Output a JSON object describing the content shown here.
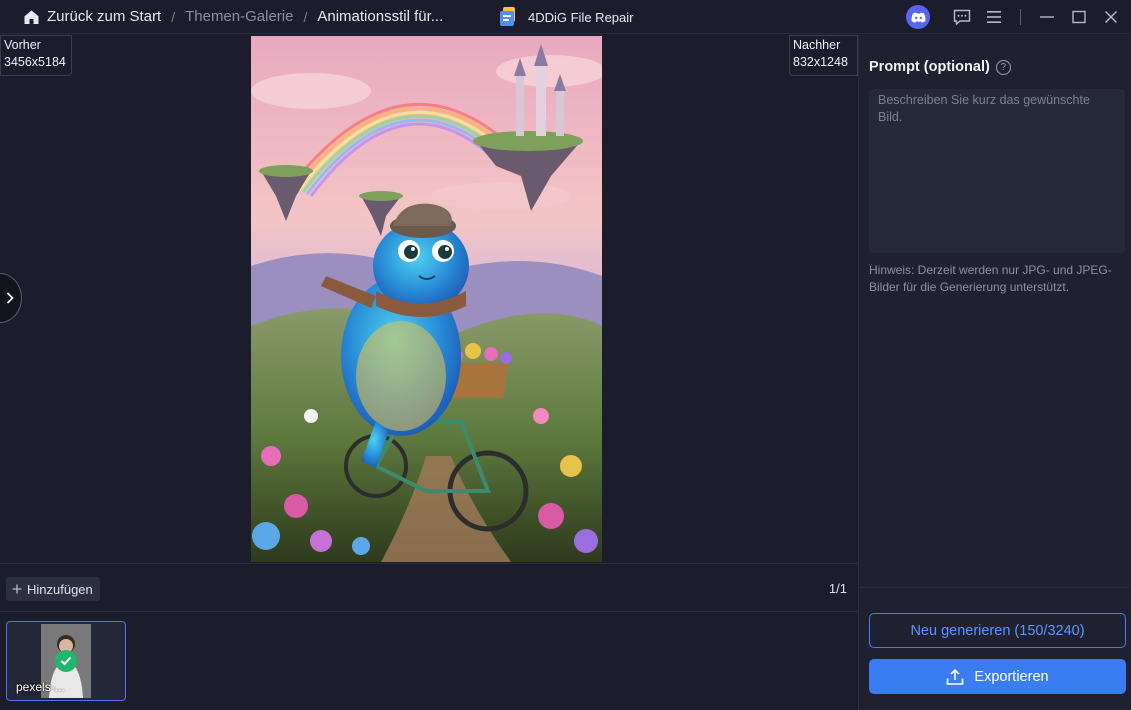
{
  "breadcrumb": {
    "home": "Zurück zum Start",
    "gallery": "Themen-Galerie",
    "current": "Animationsstil für..."
  },
  "app": {
    "title": "4DDiG File Repair"
  },
  "preview": {
    "before_label": "Vorher",
    "before_size": "3456x5184",
    "after_label": "Nachher",
    "after_size": "832x1248"
  },
  "actions": {
    "add_label": "Hinzufügen",
    "page_count": "1/1"
  },
  "thumbnails": [
    {
      "name": "pexels-..."
    }
  ],
  "panel": {
    "prompt_title": "Prompt (optional)",
    "prompt_placeholder": "Beschreiben Sie kurz das gewünschte Bild.",
    "hint": "Hinweis: Derzeit werden nur JPG- und JPEG-Bilder für die Generierung unterstützt.",
    "regenerate_label": "Neu generieren (150/3240)",
    "export_label": "Exportieren"
  },
  "colors": {
    "background": "#1b1d2c",
    "panel": "#1f2131",
    "accent": "#3a7cf2",
    "discord": "#5865f2",
    "success": "#22b66c"
  }
}
